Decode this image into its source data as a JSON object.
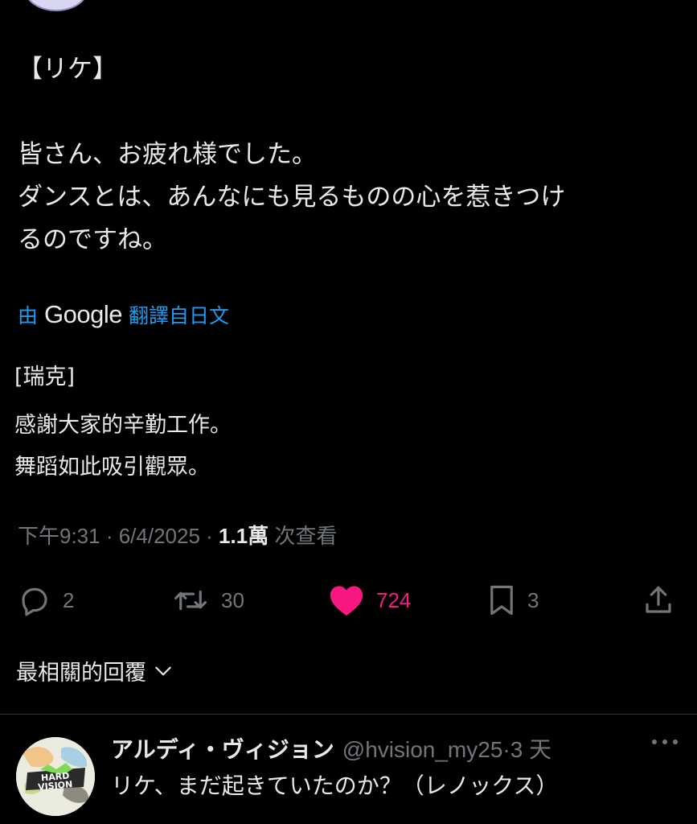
{
  "tweet": {
    "original_lines": [
      "【リケ】",
      "",
      "皆さん、お疲れ様でした。",
      "ダンスとは、あんなにも見るものの心を惹きつけ",
      "るのですね。"
    ],
    "translation_prefix": "由",
    "translation_brand": "Google",
    "translation_suffix": "翻譯自日文",
    "translated_lines": [
      "[瑞克]",
      "感謝大家的辛勤工作。",
      "舞蹈如此吸引觀眾。"
    ],
    "time": "下午9:31",
    "sep1": " · ",
    "date": "6/4/2025",
    "sep2": " · ",
    "views_count": "1.1萬",
    "views_label": " 次查看"
  },
  "actions": {
    "replies": "2",
    "reposts": "30",
    "likes": "724",
    "bookmarks": "3"
  },
  "colors": {
    "like": "#f91880",
    "link": "#1d9bf0",
    "muted": "#71767b"
  },
  "replies_filter": {
    "label": "最相關的回覆"
  },
  "reply": {
    "name": "アルディ・ヴィジョン",
    "handle": "@hvision_my25",
    "sep": "·",
    "age": "3 天",
    "text": "リケ、まだ起きていたのか？（レノックス）",
    "avatar_logo_text": "HARD VISION"
  }
}
